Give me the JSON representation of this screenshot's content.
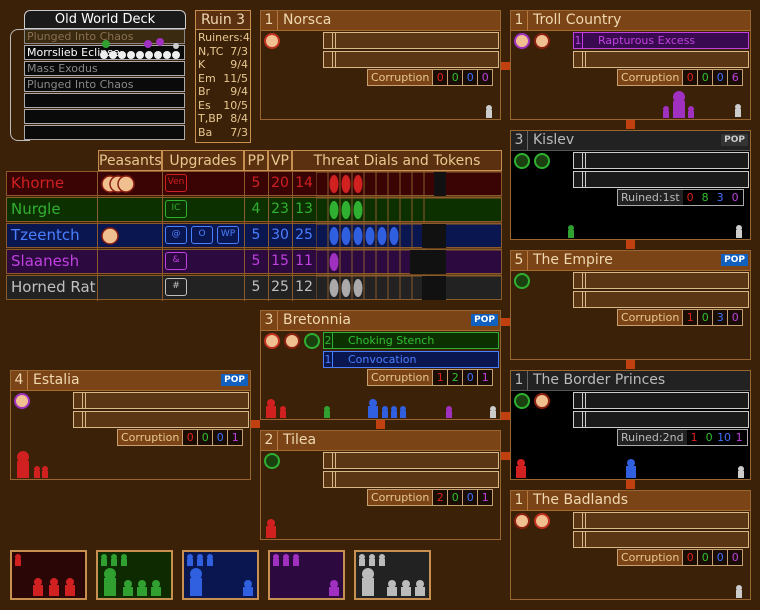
{
  "deck": {
    "title": "Old World Deck",
    "items": [
      "Plunged Into Chaos",
      "Morrslieb Eclipse",
      "Mass Exodus",
      "Plunged Into Chaos",
      "",
      "",
      "",
      ""
    ]
  },
  "ruin": {
    "title": "Ruin 3",
    "lines": [
      [
        "Ruiners:",
        "4"
      ],
      [
        "N,TC",
        "7/3"
      ],
      [
        "K",
        "9/4"
      ],
      [
        "Em",
        "11/5"
      ],
      [
        "Br",
        "9/4"
      ],
      [
        "Es",
        "10/5"
      ],
      [
        "T,BP",
        "8/4"
      ],
      [
        "Ba",
        "7/3"
      ]
    ]
  },
  "table": {
    "headers": [
      "Peasants",
      "Upgrades",
      "PP",
      "VP",
      "Threat Dials and Tokens"
    ],
    "rows": [
      {
        "name": "Khorne",
        "pp": "5",
        "vp": "20",
        "threat": "14",
        "color": "#d02020",
        "bg": "#3a0404",
        "upgrades": [
          "Ven"
        ]
      },
      {
        "name": "Nurgle",
        "pp": "4",
        "vp": "23",
        "threat": "13",
        "color": "#30b030",
        "bg": "#0d3000",
        "upgrades": [
          "IC"
        ]
      },
      {
        "name": "Tzeentch",
        "pp": "5",
        "vp": "30",
        "threat": "25",
        "color": "#4a80ff",
        "bg": "#0a1650",
        "upgrades": [
          "@",
          "O",
          "WP"
        ]
      },
      {
        "name": "Slaanesh",
        "pp": "5",
        "vp": "15",
        "threat": "11",
        "color": "#c040e0",
        "bg": "#2c0a40",
        "upgrades": [
          "&"
        ]
      },
      {
        "name": "Horned Rat",
        "pp": "5",
        "vp": "25",
        "threat": "12",
        "color": "#c0c0c0",
        "bg": "#222222",
        "upgrades": [
          "#"
        ]
      }
    ]
  },
  "regions": {
    "norsca": {
      "num": "1",
      "name": "Norsca",
      "corruption": [
        "0",
        "0",
        "0",
        "0"
      ]
    },
    "troll": {
      "num": "1",
      "name": "Troll Country",
      "card": "Rapturous Excess",
      "cardnum": "1",
      "corruption": [
        "0",
        "0",
        "0",
        "6"
      ]
    },
    "kislev": {
      "num": "3",
      "name": "Kislev",
      "pop": "POP",
      "ruined": "Ruined:1st",
      "vals": [
        "0",
        "8",
        "3",
        "0"
      ]
    },
    "empire": {
      "num": "5",
      "name": "The Empire",
      "pop": "POP",
      "corruption": [
        "1",
        "0",
        "3",
        "0"
      ]
    },
    "bretonnia": {
      "num": "3",
      "name": "Bretonnia",
      "pop": "POP",
      "card1": "Choking Stench",
      "card1num": "2",
      "card2": "Convocation",
      "card2num": "1",
      "corruption": [
        "1",
        "2",
        "0",
        "1"
      ]
    },
    "estalia": {
      "num": "4",
      "name": "Estalia",
      "pop": "POP",
      "corruption": [
        "0",
        "0",
        "0",
        "1"
      ]
    },
    "border": {
      "num": "1",
      "name": "The Border Princes",
      "ruined": "Ruined:2nd",
      "vals": [
        "1",
        "0",
        "10",
        "1"
      ]
    },
    "tilea": {
      "num": "2",
      "name": "Tilea",
      "corruption": [
        "2",
        "0",
        "0",
        "1"
      ]
    },
    "badlands": {
      "num": "1",
      "name": "The Badlands",
      "corruption": [
        "0",
        "0",
        "0",
        "0"
      ]
    },
    "label_corruption": "Corruption"
  },
  "colors": {
    "khorne": "#d02020",
    "nurgle": "#30b030",
    "tzeentch": "#3060e0",
    "slaanesh": "#a030c0",
    "rat": "#c0c0c0"
  }
}
